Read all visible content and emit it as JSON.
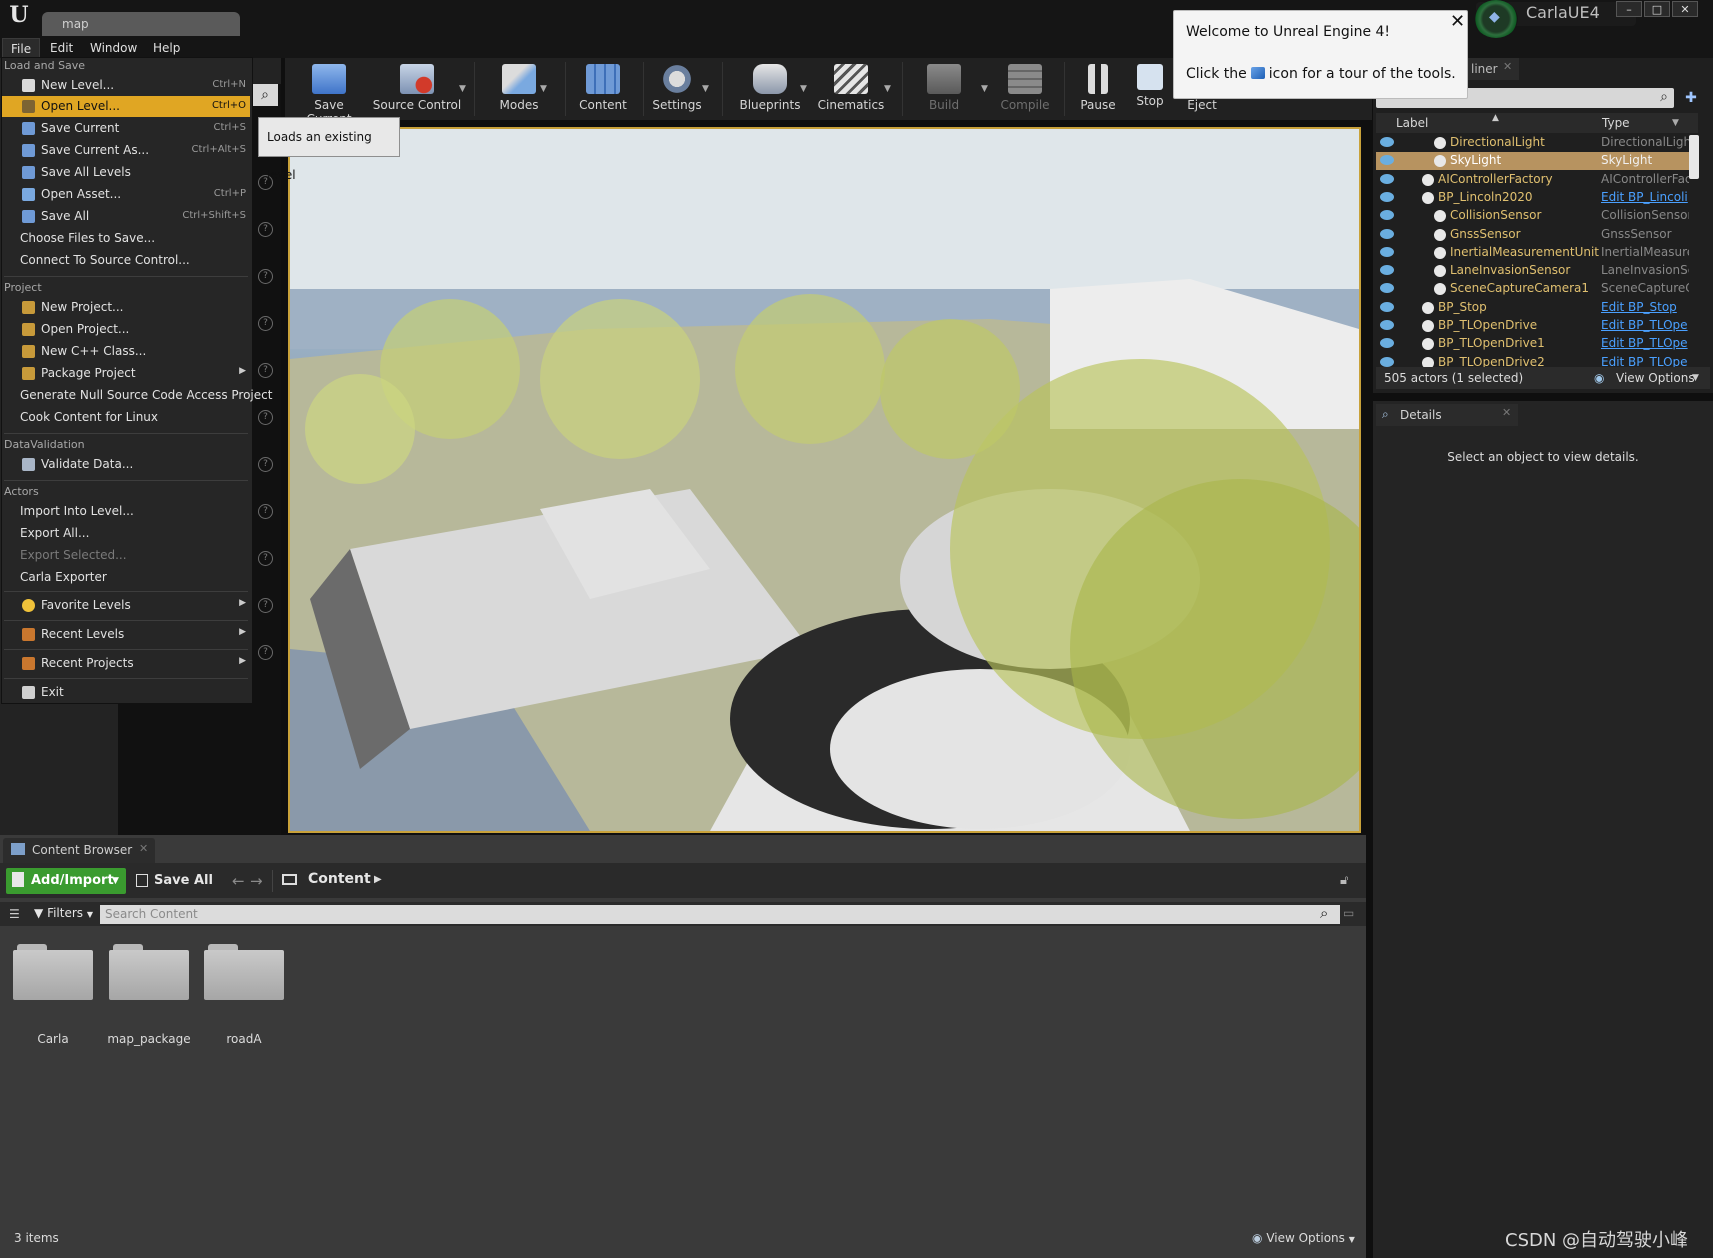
{
  "window": {
    "tab_title": "map",
    "project_name": "CarlaUE4",
    "controls": [
      "–",
      "□",
      "✕"
    ]
  },
  "menubar": [
    "File",
    "Edit",
    "Window",
    "Help"
  ],
  "toolbar": [
    {
      "label": "Save Current",
      "icon": "save-icon",
      "arrow": false,
      "disabled": false
    },
    {
      "label": "Source Control",
      "icon": "source-control-icon",
      "arrow": true,
      "disabled": false
    },
    {
      "label": "Modes",
      "icon": "modes-icon",
      "arrow": true,
      "disabled": false
    },
    {
      "label": "Content",
      "icon": "content-icon",
      "arrow": false,
      "disabled": false
    },
    {
      "label": "Settings",
      "icon": "settings-icon",
      "arrow": true,
      "disabled": false
    },
    {
      "label": "Blueprints",
      "icon": "blueprints-icon",
      "arrow": true,
      "disabled": false
    },
    {
      "label": "Cinematics",
      "icon": "cinematics-icon",
      "arrow": true,
      "disabled": false
    },
    {
      "label": "Build",
      "icon": "build-icon",
      "arrow": true,
      "disabled": true
    },
    {
      "label": "Compile",
      "icon": "compile-icon",
      "arrow": false,
      "disabled": true
    },
    {
      "label": "Pause",
      "icon": "pause-icon",
      "arrow": false,
      "disabled": false
    },
    {
      "label": "Stop",
      "icon": "stop-icon",
      "arrow": false,
      "disabled": false
    },
    {
      "label": "Eject",
      "icon": "eject-icon",
      "arrow": false,
      "disabled": false
    }
  ],
  "tooltip": "Loads an existing level",
  "file_menu": {
    "sections": {
      "load_and_save": "Load and Save",
      "project": "Project",
      "data_validation": "DataValidation",
      "actors": "Actors"
    },
    "items": {
      "new_level": {
        "label": "New Level...",
        "shortcut": "Ctrl+N"
      },
      "open_level": {
        "label": "Open Level...",
        "shortcut": "Ctrl+O"
      },
      "save_current": {
        "label": "Save Current",
        "shortcut": "Ctrl+S"
      },
      "save_current_as": {
        "label": "Save Current As...",
        "shortcut": "Ctrl+Alt+S"
      },
      "save_all_levels": {
        "label": "Save All Levels",
        "shortcut": ""
      },
      "open_asset": {
        "label": "Open Asset...",
        "shortcut": "Ctrl+P"
      },
      "save_all": {
        "label": "Save All",
        "shortcut": "Ctrl+Shift+S"
      },
      "choose_files": {
        "label": "Choose Files to Save...",
        "shortcut": ""
      },
      "connect_source": {
        "label": "Connect To Source Control...",
        "shortcut": ""
      },
      "new_project": {
        "label": "New Project...",
        "shortcut": ""
      },
      "open_project": {
        "label": "Open Project...",
        "shortcut": ""
      },
      "new_cpp_class": {
        "label": "New C++ Class...",
        "shortcut": ""
      },
      "package_project": {
        "label": "Package Project",
        "shortcut": ""
      },
      "gen_null_source": {
        "label": "Generate Null Source Code Access Project",
        "shortcut": ""
      },
      "cook_linux": {
        "label": "Cook Content for Linux",
        "shortcut": ""
      },
      "validate_data": {
        "label": "Validate Data...",
        "shortcut": ""
      },
      "import_into_level": {
        "label": "Import Into Level...",
        "shortcut": ""
      },
      "export_all": {
        "label": "Export All...",
        "shortcut": ""
      },
      "export_selected": {
        "label": "Export Selected...",
        "shortcut": ""
      },
      "carla_exporter": {
        "label": "Carla Exporter",
        "shortcut": ""
      },
      "favorite_levels": {
        "label": "Favorite Levels",
        "shortcut": ""
      },
      "recent_levels": {
        "label": "Recent Levels",
        "shortcut": ""
      },
      "recent_projects": {
        "label": "Recent Projects",
        "shortcut": ""
      },
      "exit": {
        "label": "Exit",
        "shortcut": ""
      }
    }
  },
  "welcome": {
    "title": "Welcome to Unreal Engine 4!",
    "body_before": "Click the",
    "body_after": "icon for a tour of the tools.",
    "close": "✕"
  },
  "outliner": {
    "tab_label": "liner",
    "col_label": "Label",
    "col_type": "Type",
    "rows": [
      {
        "name": "DirectionalLight",
        "type": "DirectionalLight",
        "link": false,
        "selected": false
      },
      {
        "name": "SkyLight",
        "type": "SkyLight",
        "link": false,
        "selected": true
      },
      {
        "name": "AIControllerFactory",
        "type": "AIControllerFac",
        "link": false,
        "selected": false
      },
      {
        "name": "BP_Lincoln2020",
        "type": "Edit BP_Lincoli",
        "link": true,
        "selected": false
      },
      {
        "name": "CollisionSensor",
        "type": "CollisionSensor",
        "link": false,
        "selected": false
      },
      {
        "name": "GnssSensor",
        "type": "GnssSensor",
        "link": false,
        "selected": false
      },
      {
        "name": "InertialMeasurementUnit",
        "type": "InertialMeasure",
        "link": false,
        "selected": false
      },
      {
        "name": "LaneInvasionSensor",
        "type": "LaneInvasionSe",
        "link": false,
        "selected": false
      },
      {
        "name": "SceneCaptureCamera1",
        "type": "SceneCaptureC",
        "link": false,
        "selected": false
      },
      {
        "name": "BP_Stop",
        "type": "Edit BP_Stop",
        "link": true,
        "selected": false
      },
      {
        "name": "BP_TLOpenDrive",
        "type": "Edit BP_TLOpe",
        "link": true,
        "selected": false
      },
      {
        "name": "BP_TLOpenDrive1",
        "type": "Edit BP_TLOpe",
        "link": true,
        "selected": false
      },
      {
        "name": "BP_TLOpenDrive2",
        "type": "Edit BP_TLOpe",
        "link": true,
        "selected": false
      }
    ],
    "footer_count": "505 actors (1 selected)",
    "view_options": "View Options"
  },
  "details": {
    "tab_label": "Details",
    "empty_message": "Select an object to view details."
  },
  "content_browser": {
    "tab_label": "Content Browser",
    "add_import": "Add/Import",
    "save_all": "Save All",
    "path": "Content",
    "filters": "Filters",
    "search_placeholder": "Search Content",
    "folders": [
      "Carla",
      "map_package",
      "roadA"
    ],
    "item_count": "3 items",
    "view_options": "View Options"
  },
  "watermark": "CSDN @自动驾驶小峰",
  "colors": {
    "accent_selected": "#e0a623",
    "viewport_border": "#c9a23a",
    "add_import_green": "#3a9b2f",
    "link_blue": "#4aa0ff"
  }
}
